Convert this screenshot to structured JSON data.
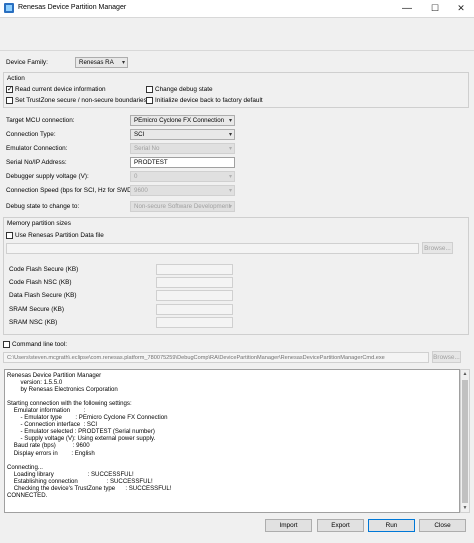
{
  "window": {
    "title": "Renesas Device Partition Manager",
    "minimize": "—",
    "maximize": "☐",
    "close": "✕"
  },
  "device_family": {
    "label": "Device Family:",
    "value": "Renesas RA"
  },
  "action": {
    "group_label": "Action",
    "read_info": {
      "label": "Read current device information",
      "checked": true
    },
    "change_debug": {
      "label": "Change debug state",
      "checked": false
    },
    "set_trustzone": {
      "label": "Set TrustZone secure / non-secure boundaries",
      "checked": false
    },
    "initialize": {
      "label": "Initialize device back to factory default",
      "checked": false
    }
  },
  "settings": {
    "target_mcu": {
      "label": "Target MCU connection:",
      "value": "PEmicro Cyclone FX Connection"
    },
    "connection_type": {
      "label": "Connection Type:",
      "value": "SCI"
    },
    "emulator_connection": {
      "label": "Emulator Connection:",
      "value": "Serial No"
    },
    "serial_no": {
      "label": "Serial No/IP Address:",
      "value": "PRODTEST"
    },
    "supply_voltage": {
      "label": "Debugger supply voltage (V):",
      "value": "0"
    },
    "connection_speed": {
      "label": "Connection Speed (bps for SCI, Hz for SWD):",
      "value": "9600"
    },
    "debug_state": {
      "label": "Debug state to change to:",
      "value": "Non-secure Software Development"
    }
  },
  "memory": {
    "group_label": "Memory partition sizes",
    "use_file_label": "Use Renesas Partition Data file",
    "file_path": "",
    "browse_label": "Browse...",
    "fields": [
      {
        "label": "Code Flash Secure (KB)",
        "value": ""
      },
      {
        "label": "Code Flash NSC (KB)",
        "value": ""
      },
      {
        "label": "Data Flash Secure (KB)",
        "value": ""
      },
      {
        "label": "SRAM Secure (KB)",
        "value": ""
      },
      {
        "label": "SRAM NSC (KB)",
        "value": ""
      }
    ]
  },
  "command_line": {
    "label": "Command line tool:",
    "path": "C:\\Users\\steven.mcgrath\\.eclipse\\com.renesas.platform_780075259\\DebugComp\\RA\\DevicePartitionManager\\RenesasDevicePartitionManagerCmd.exe",
    "browse_label": "Browse..."
  },
  "console_text": "Renesas Device Partition Manager\n        version: 1.5.5.0\n        by Renesas Electronics Corporation\n\nStarting connection with the following settings:\n    Emulator information        :\n        - Emulator type        : PEmicro Cyclone FX Connection\n        - Connection interface  : SCI\n        - Emulator selected : PRODTEST (Serial number)\n        - Supply voltage (V): Using external power supply.\n    Baud rate (bps)          : 9600\n    Display errors in        : English\n\nConnecting...\n    Loading library                    : SUCCESSFUL!\n    Establishing connection                 : SUCCESSFUL!\n    Checking the device's TrustZone type      : SUCCESSFUL!\nCONNECTED.",
  "buttons": {
    "import": "Import",
    "export": "Export",
    "run": "Run",
    "close": "Close"
  }
}
